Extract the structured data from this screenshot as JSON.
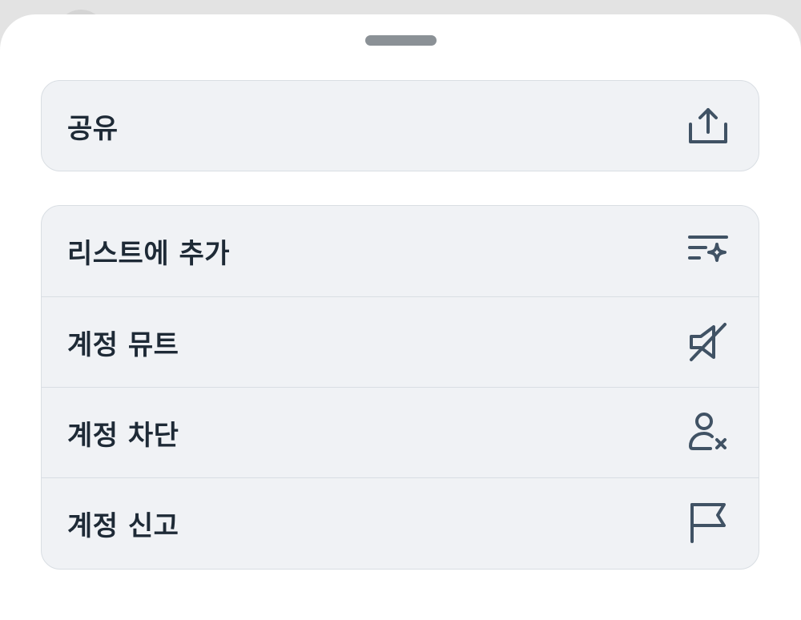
{
  "theme": {
    "icon_color": "#405264",
    "label_color": "#1e2a36",
    "row_background": "#f0f2f5"
  },
  "share_group": {
    "share": {
      "label": "공유",
      "icon": "share-icon"
    }
  },
  "actions_group": {
    "items": [
      {
        "label": "리스트에 추가",
        "icon": "list-add-sparkle-icon"
      },
      {
        "label": "계정 뮤트",
        "icon": "speaker-muted-icon"
      },
      {
        "label": "계정 차단",
        "icon": "person-block-icon"
      },
      {
        "label": "계정 신고",
        "icon": "flag-icon"
      }
    ]
  }
}
